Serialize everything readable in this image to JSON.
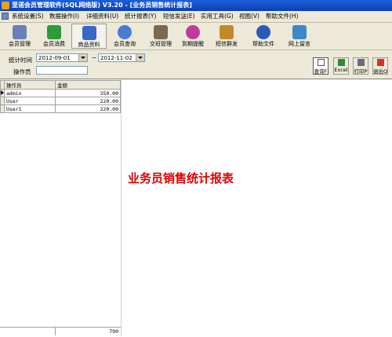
{
  "window": {
    "title": "里诺会员管理软件(SQL网络版) V3.20 - [业务员销售统计报表]"
  },
  "menu": [
    "系统设置(S)",
    "数据操作(I)",
    "详细资料(U)",
    "统计报表(Y)",
    "短信发送(E)",
    "实用工具(G)",
    "视图(V)",
    "帮助文件(H)"
  ],
  "toolbar": [
    {
      "label": "会员管理",
      "icon": "member-icon",
      "color": "#6b7fb8"
    },
    {
      "label": "会员消费",
      "icon": "money-icon",
      "color": "#2f9a3a"
    },
    {
      "label": "商品资料",
      "icon": "product-icon",
      "color": "#3568c8"
    },
    {
      "label": "会员查询",
      "icon": "search-icon",
      "color": "#4a7bd0"
    },
    {
      "label": "交班管理",
      "icon": "shift-icon",
      "color": "#7a6a50"
    },
    {
      "label": "到期提醒",
      "icon": "reminder-icon",
      "color": "#c03a9a"
    },
    {
      "label": "短信群发",
      "icon": "sms-icon",
      "color": "#c08a2a"
    },
    {
      "label": "帮助文件",
      "icon": "help-icon",
      "color": "#2a5ab8"
    },
    {
      "label": "网上留言",
      "icon": "message-icon",
      "color": "#3a8ac8"
    }
  ],
  "filters": {
    "period_label": "统计时间",
    "date_from": "2012-09-01",
    "separator": "~",
    "date_to": "2012-11-02",
    "operator_label": "操作员",
    "operator_value": ""
  },
  "actions": {
    "query": "查询F",
    "excel": "Excel",
    "print": "打印P",
    "exit": "退出Q"
  },
  "table": {
    "headers": [
      "操作员",
      "金额"
    ],
    "rows": [
      {
        "operator": "admin",
        "amount": "350.00"
      },
      {
        "operator": "User",
        "amount": "220.00"
      },
      {
        "operator": "User1",
        "amount": "220.00"
      }
    ],
    "total": "790"
  },
  "report_title": "业务员销售统计报表"
}
